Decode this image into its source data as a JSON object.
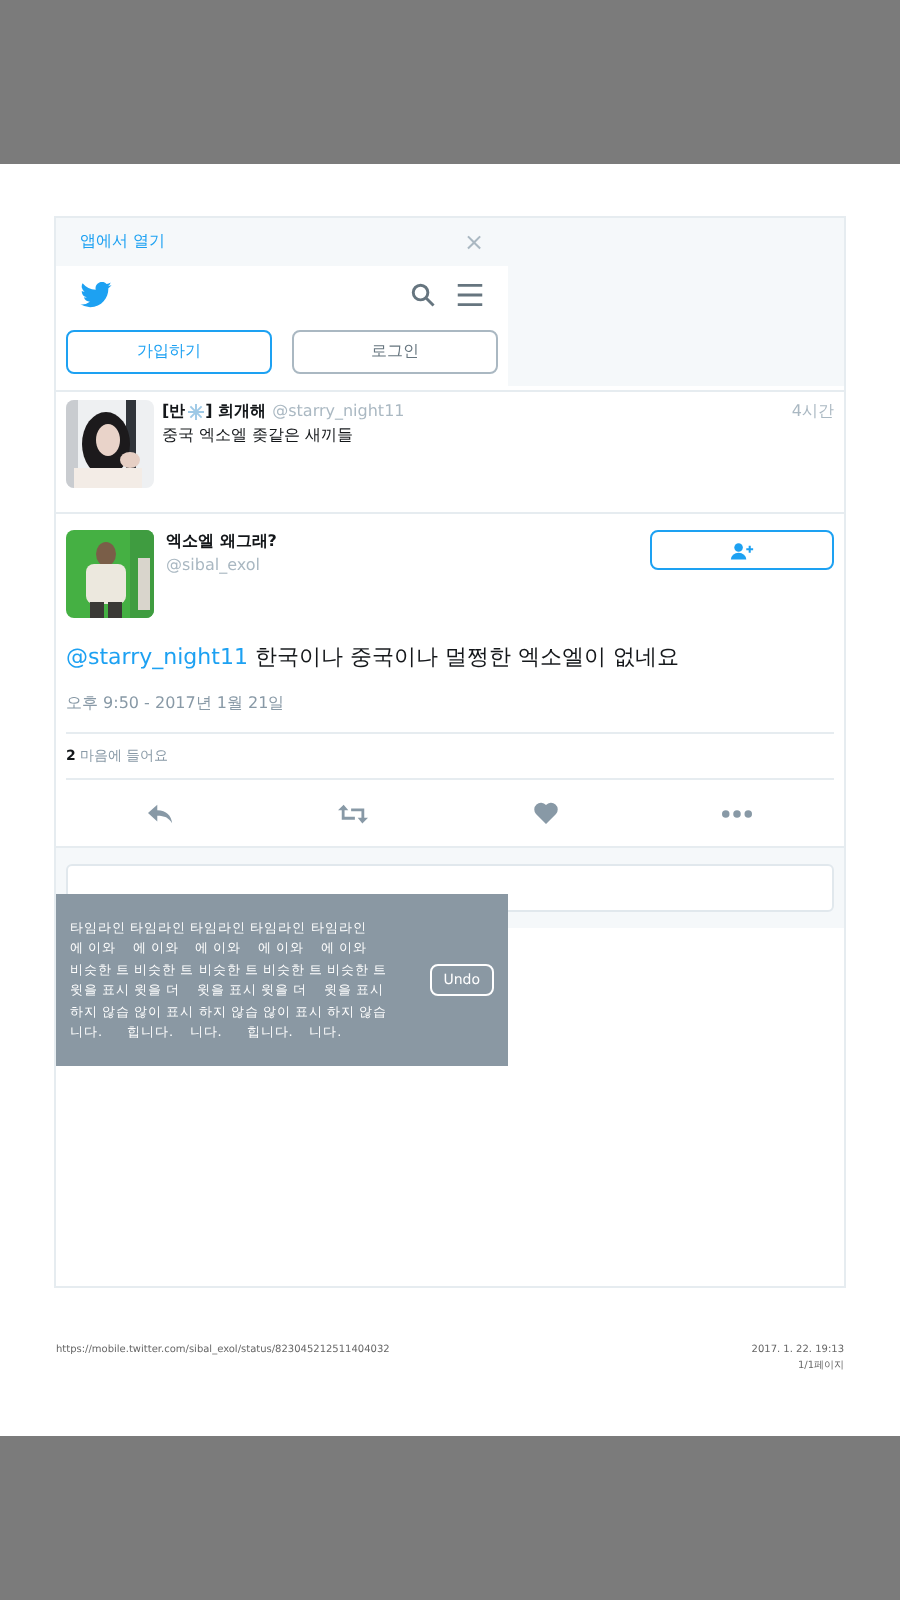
{
  "banner": {
    "open_in_app": "앱에서 열기",
    "close": "×"
  },
  "header": {
    "signup": "가입하기",
    "login": "로그인"
  },
  "parent_tweet": {
    "name_prefix": "[반",
    "name_suffix": "] 희개해",
    "handle": "@starry_night11",
    "time": "4시간",
    "text": "중국 엑소엘 좆같은 새끼들"
  },
  "main_tweet": {
    "name": "엑소엘 왜그래?",
    "handle": "@sibal_exol",
    "mention": "@starry_night11",
    "text": "한국이나 중국이나 멀쩡한 엑소엘이 없네요",
    "timestamp": "오후 9:50 - 2017년 1월 21일",
    "likes_count": "2",
    "likes_label": "마음에 들어요"
  },
  "toast": {
    "lines": [
      "타임라인 타임라인 타임라인 타임라인 타임라인",
      "에 이와    에 이와    에 이와    에 이와    에 이와",
      "비슷한 트 비슷한 트 비슷한 트 비슷한 트 비슷한 트",
      "윗을 표시 윗을 더    윗을 표시 윗을 더    윗을 표시",
      "하지 않습 않이 표시 하지 않습 않이 표시 하지 않습",
      "니다.      힙니다.    니다.      힙니다.    니다."
    ],
    "undo": "Undo"
  },
  "footer": {
    "url": "https://mobile.twitter.com/sibal_exol/status/823045212511404032",
    "date": "2017. 1. 22. 19:13",
    "page": "1/1페이지"
  }
}
